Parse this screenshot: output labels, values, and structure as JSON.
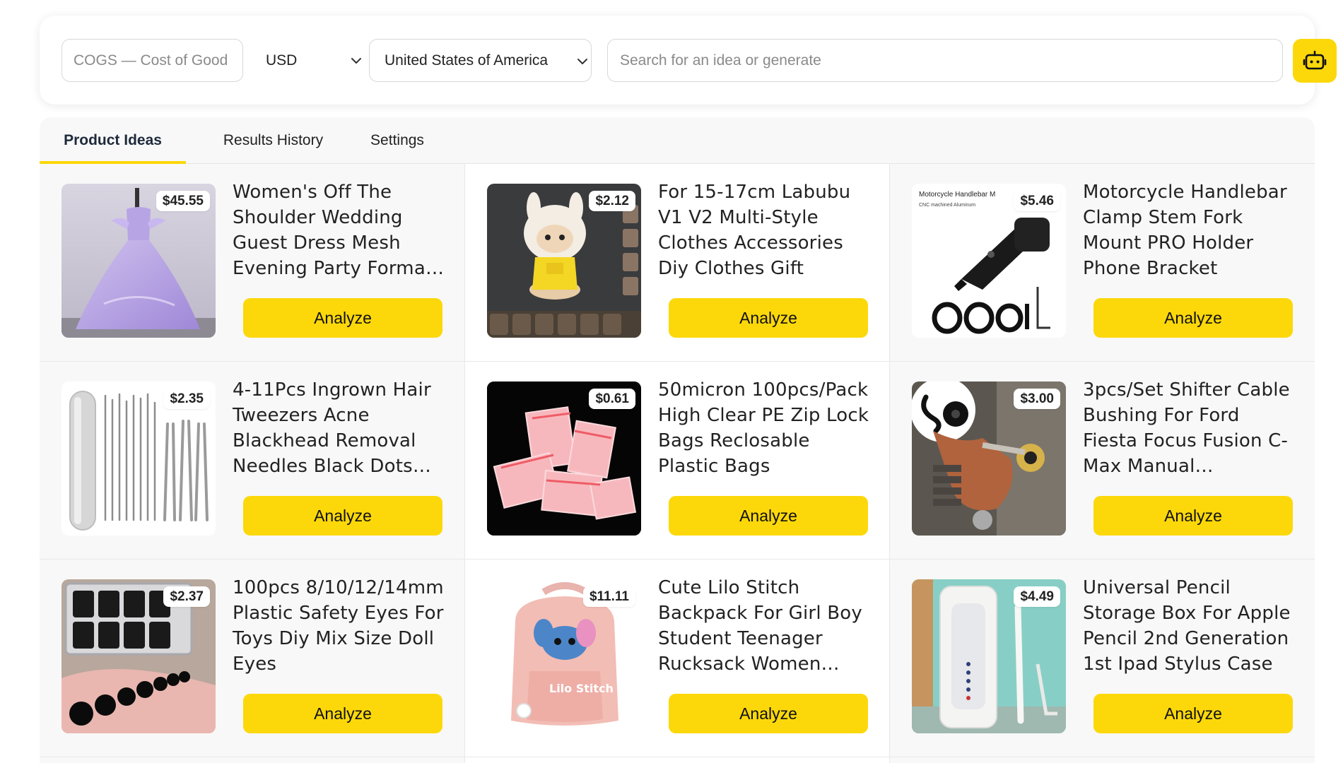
{
  "toolbar": {
    "cogs_placeholder": "COGS — Cost of Good",
    "currency": "USD",
    "country": "United States of America",
    "search_placeholder": "Search for an idea or generate",
    "generate_icon": "robot-icon",
    "accent_color": "#fcd80a"
  },
  "tabs": [
    {
      "label": "Product Ideas",
      "active": true
    },
    {
      "label": "Results History",
      "active": false
    },
    {
      "label": "Settings",
      "active": false
    }
  ],
  "products": [
    {
      "price": "$45.55",
      "title": "Women's Off The Shoulder Wedding Guest Dress Mesh Evening Party Formal Dress",
      "button": "Analyze",
      "image": "purple-gown-image"
    },
    {
      "price": "$2.12",
      "title": "For 15-17cm Labubu V1 V2 Multi-Style Clothes Accessories Diy Clothes Gift",
      "button": "Analyze",
      "image": "doll-clothes-image"
    },
    {
      "price": "$5.46",
      "title": "Motorcycle Handlebar Clamp Stem Fork Mount PRO Holder Phone Bracket",
      "button": "Analyze",
      "image": "handlebar-mount-image"
    },
    {
      "price": "$2.35",
      "title": "4-11Pcs Ingrown Hair Tweezers Acne Blackhead Removal Needles Black Dots Remover",
      "button": "Analyze",
      "image": "tweezers-kit-image"
    },
    {
      "price": "$0.61",
      "title": "50micron 100pcs/Pack High Clear PE Zip Lock Bags Reclosable Plastic Bags",
      "button": "Analyze",
      "image": "zip-bags-image"
    },
    {
      "price": "$3.00",
      "title": "3pcs/Set Shifter Cable Bushing For Ford Fiesta Focus Fusion C-Max Manual Transmission",
      "button": "Analyze",
      "image": "shifter-bushing-image"
    },
    {
      "price": "$2.37",
      "title": "100pcs 8/10/12/14mm Plastic Safety Eyes For Toys Diy Mix Size Doll Eyes",
      "button": "Analyze",
      "image": "safety-eyes-image"
    },
    {
      "price": "$11.11",
      "title": "Cute Lilo Stitch Backpack For Girl Boy Student Teenager Rucksack Women School Bag",
      "button": "Analyze",
      "image": "stitch-backpack-image",
      "image_text": "Lilo Stitch"
    },
    {
      "price": "$4.49",
      "title": "Universal Pencil Storage Box For Apple Pencil 2nd Generation 1st Ipad Stylus Case",
      "button": "Analyze",
      "image": "pencil-case-image"
    }
  ],
  "image_text": {
    "handlebar_caption": "Motorcycle Handlebar M",
    "handlebar_sub": "CNC machined Aluminum"
  }
}
